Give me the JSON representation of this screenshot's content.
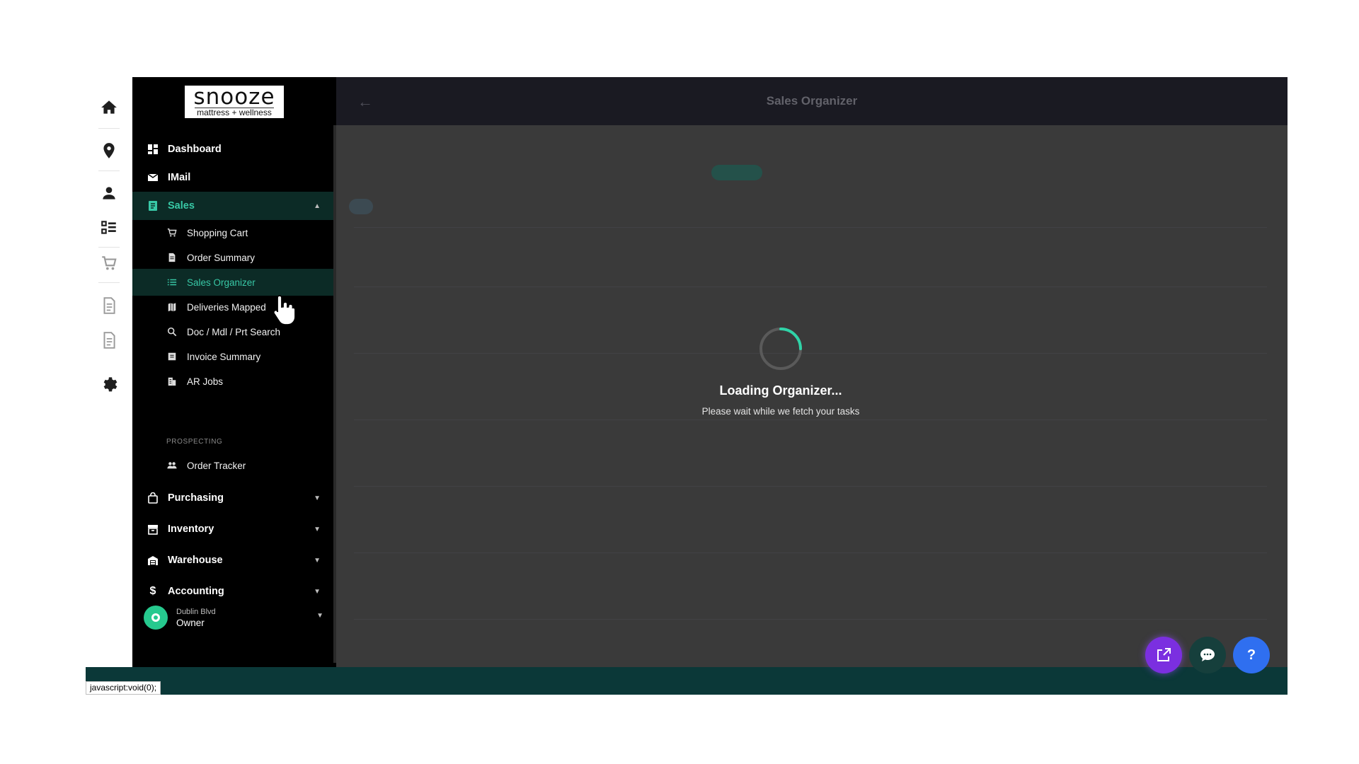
{
  "brand": {
    "logo_top": "snooze",
    "logo_bottom": "mattress + wellness"
  },
  "rail": {
    "icons": [
      "home-icon",
      "location-pin-icon",
      "person-icon",
      "checklist-icon",
      "cart-icon",
      "document-icon",
      "document-icon",
      "gear-icon"
    ]
  },
  "sidebar": {
    "dashboard": "Dashboard",
    "imail": "IMail",
    "sales": "Sales",
    "sales_items": [
      {
        "label": "Shopping Cart",
        "icon": "cart-icon"
      },
      {
        "label": "Order Summary",
        "icon": "document-icon"
      },
      {
        "label": "Sales Organizer",
        "icon": "list-icon"
      },
      {
        "label": "Deliveries Mapped",
        "icon": "map-icon"
      },
      {
        "label": "Doc / Mdl / Prt Search",
        "icon": "search-icon"
      },
      {
        "label": "Invoice Summary",
        "icon": "invoice-icon"
      },
      {
        "label": "AR Jobs",
        "icon": "building-icon"
      }
    ],
    "prospecting_header": "PROSPECTING",
    "order_tracker": "Order Tracker",
    "purchasing": "Purchasing",
    "inventory": "Inventory",
    "warehouse": "Warehouse",
    "accounting": "Accounting",
    "user": {
      "location": "Dublin Blvd",
      "role": "Owner"
    }
  },
  "main": {
    "title": "Sales Organizer",
    "loading_title": "Loading Organizer...",
    "loading_sub": "Please wait while we fetch your tasks"
  },
  "status_url": "javascript:void(0);",
  "colors": {
    "accent": "#38c8a6",
    "sidebar_bg": "#000000",
    "bottom_bar": "#0b3838",
    "fab_purple": "#7b2fe0",
    "fab_blue": "#2f6ff0"
  },
  "fabs": {
    "external": "external-link-icon",
    "chat": "chat-icon",
    "help": "?"
  }
}
